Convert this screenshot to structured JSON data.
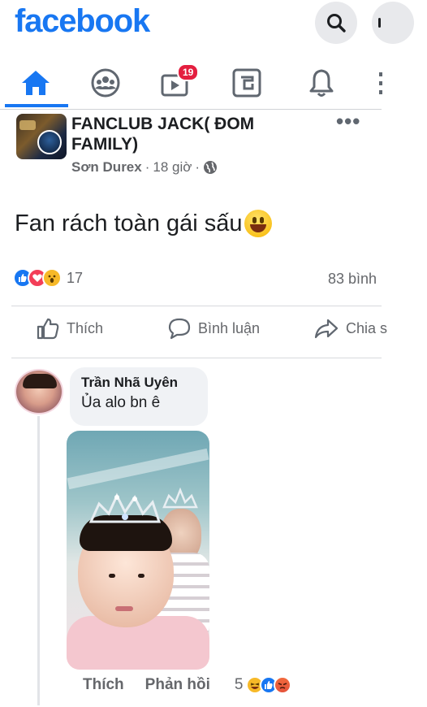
{
  "app": {
    "logo_text": "facebook",
    "brand_color": "#1877f2"
  },
  "header": {
    "icons": [
      "search-icon",
      "messenger-icon"
    ]
  },
  "tabs": [
    {
      "name": "home",
      "icon": "home-icon",
      "active": true
    },
    {
      "name": "groups",
      "icon": "groups-icon"
    },
    {
      "name": "watch",
      "icon": "video-icon",
      "badge": "19"
    },
    {
      "name": "gaming",
      "icon": "gaming-icon"
    },
    {
      "name": "notifications",
      "icon": "bell-icon"
    },
    {
      "name": "menu",
      "icon": "menu-icon"
    }
  ],
  "post": {
    "group_name": "FANCLUB JACK( ĐOM FAMILY)",
    "author": "Sơn Durex",
    "separator": "·",
    "time": "18 giờ",
    "text": "Fan rách toàn gái sấu",
    "reaction_count": "17",
    "comment_count": "83 bình",
    "actions": {
      "like": "Thích",
      "comment": "Bình luận",
      "share": "Chia s"
    }
  },
  "comment": {
    "author": "Trần Nhã Uyên",
    "text": "Ủa alo bn ê",
    "like_label": "Thích",
    "reply_label": "Phản hồi",
    "reaction_count": "5"
  }
}
